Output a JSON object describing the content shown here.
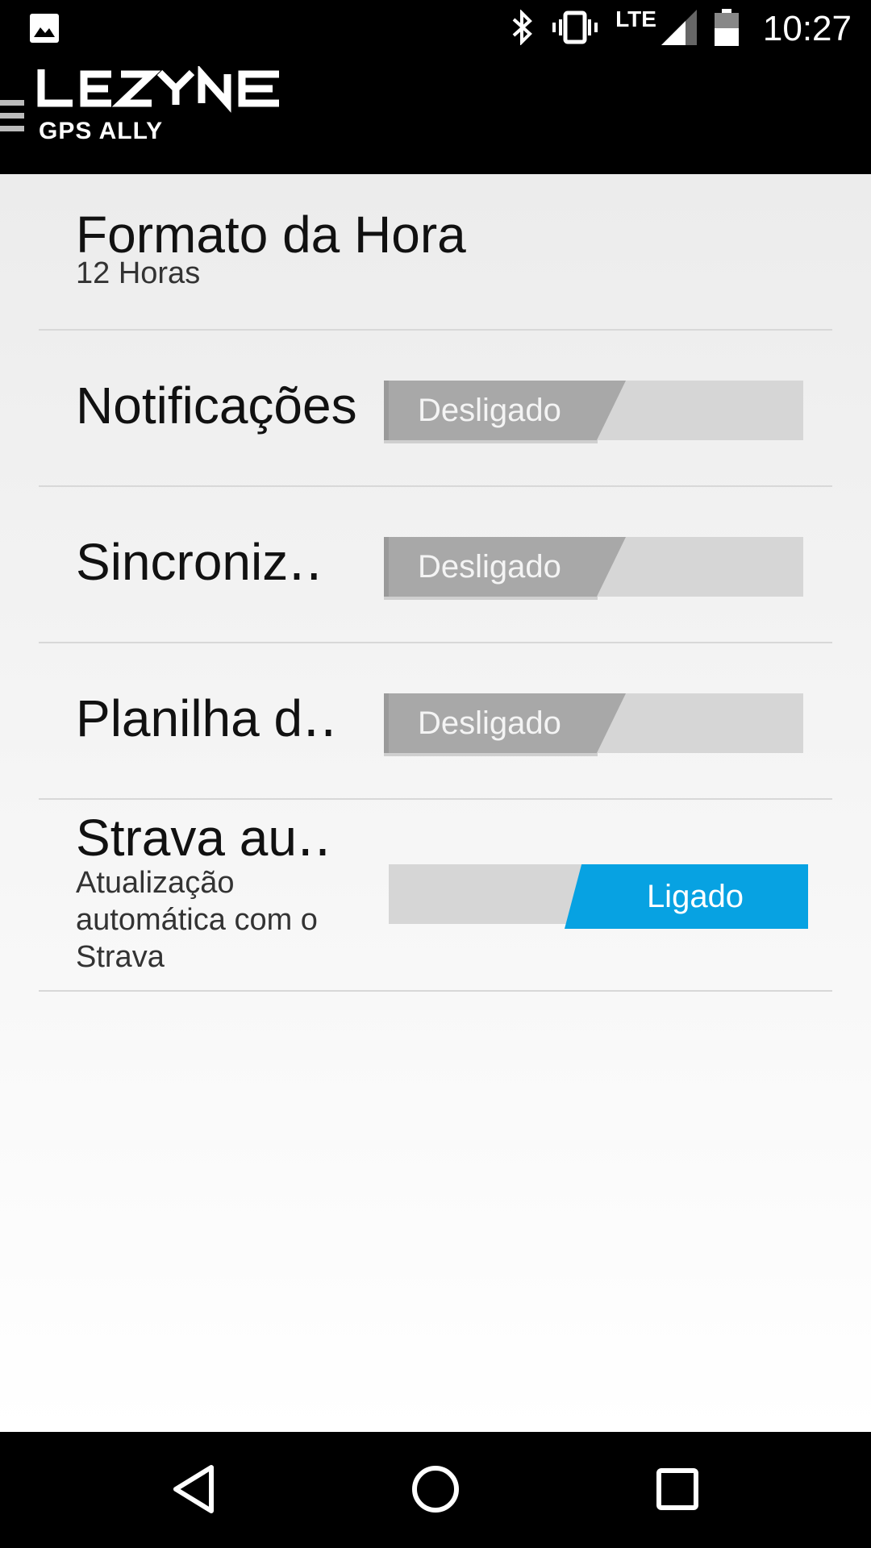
{
  "status_bar": {
    "time": "10:27",
    "network": "LTE",
    "icons": [
      "image-icon",
      "bluetooth-icon",
      "vibrate-icon",
      "signal-icon",
      "battery-icon"
    ]
  },
  "app": {
    "brand": "LEZYNE",
    "subtitle": "GPS ALLY"
  },
  "settings": [
    {
      "title": "Formato da Hora",
      "subtitle": "12 Horas"
    },
    {
      "title": "Notificações",
      "toggle": "Desligado",
      "state": "off"
    },
    {
      "title": "Sincroniz‥",
      "toggle": "Desligado",
      "state": "off"
    },
    {
      "title": "Planilha d‥",
      "toggle": "Desligado",
      "state": "off"
    },
    {
      "title": "Strava au‥",
      "subtitle": "Atualização automática com o Strava",
      "toggle": "Ligado",
      "state": "on"
    }
  ],
  "colors": {
    "accent": "#07a2e2",
    "toggle_off": "#a8a8a8",
    "track": "#d6d6d6"
  }
}
